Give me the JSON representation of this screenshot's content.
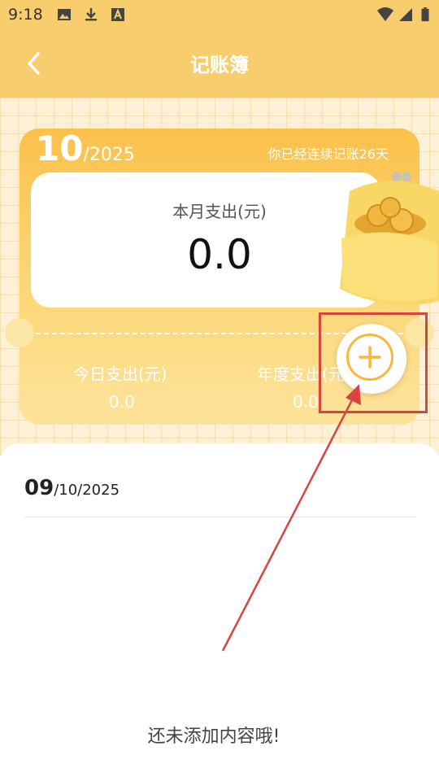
{
  "status_bar": {
    "time": "9:18",
    "icons": [
      "image-icon",
      "download-icon",
      "a-icon",
      "wifi-icon",
      "signal-icon",
      "battery-icon"
    ]
  },
  "header": {
    "title": "记账簿",
    "back_icon": "chevron-left-icon"
  },
  "summary": {
    "month": "10",
    "year": "/2025",
    "streak_text": "你已经连续记账26天",
    "month_expense_label": "本月支出(元)",
    "month_expense_value": "0.0",
    "today_expense_label": "今日支出(元)",
    "today_expense_value": "0.0",
    "year_expense_label": "年度支出(元)",
    "year_expense_value": "0.0"
  },
  "add_button": {
    "icon": "plus-icon"
  },
  "list": {
    "date_day": "09",
    "date_rest": "/10/2025",
    "empty_text": "还未添加内容哦!"
  },
  "colors": {
    "header_bg": "#f7cd6e",
    "accent": "#f4b93c",
    "highlight": "#d9443f"
  }
}
